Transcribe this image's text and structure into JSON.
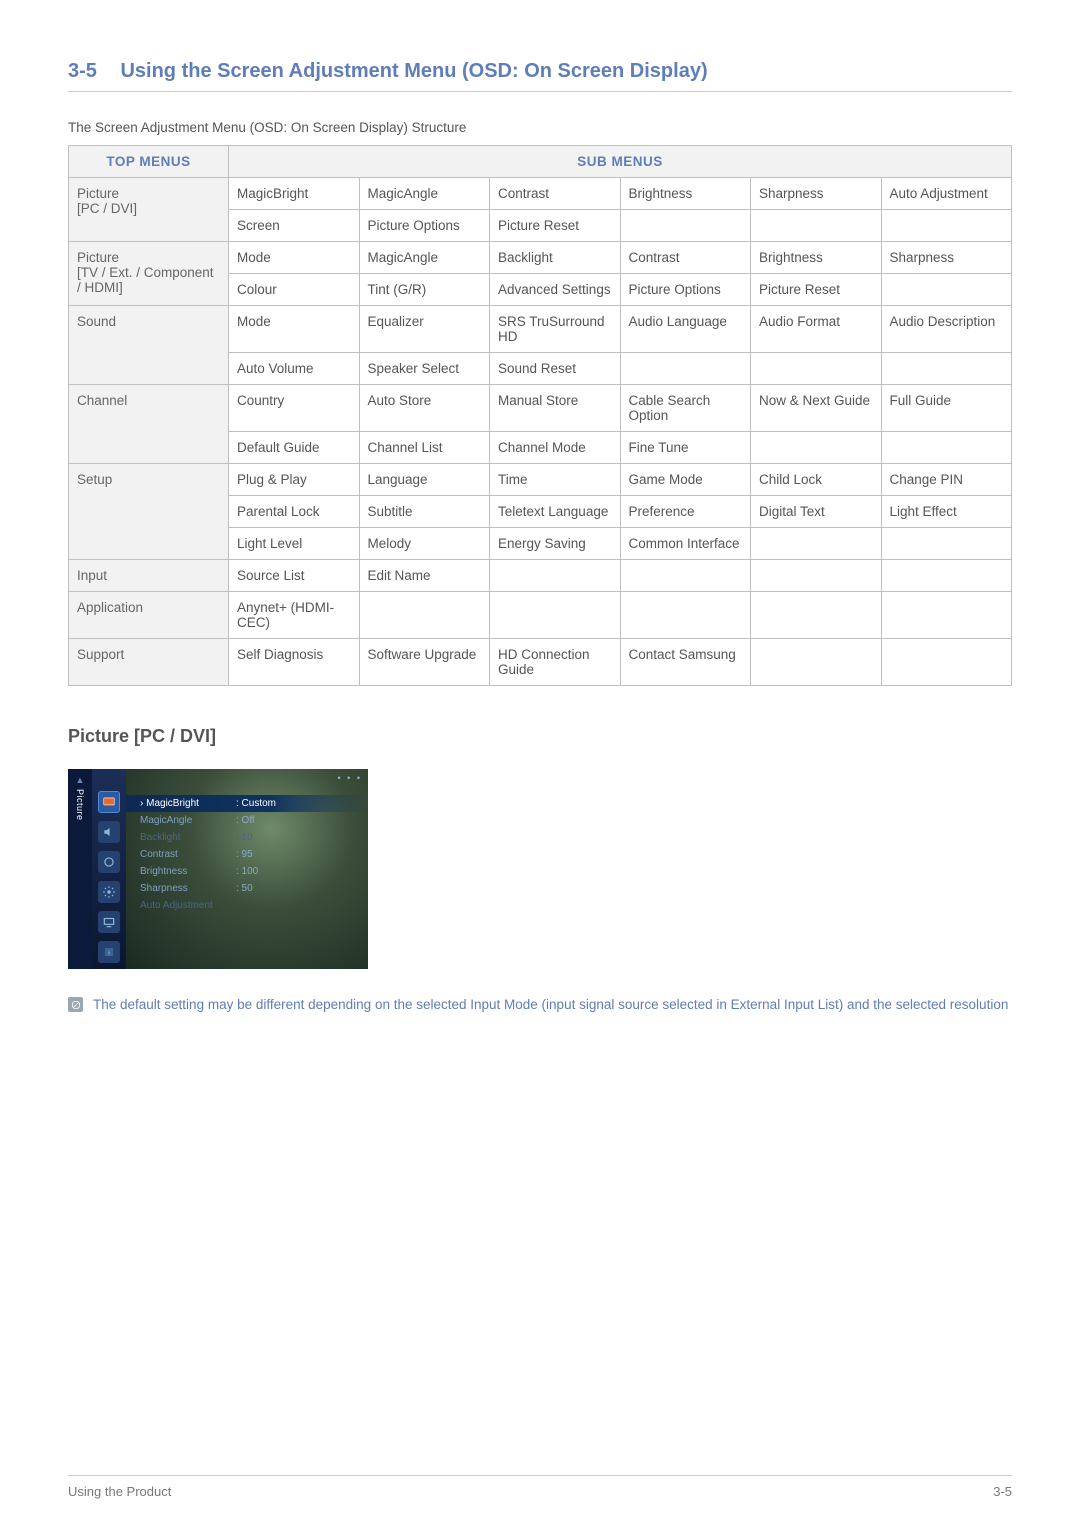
{
  "section": {
    "number": "3-5",
    "title": "Using the Screen Adjustment Menu (OSD: On Screen Display)"
  },
  "intro": "The Screen Adjustment Menu (OSD: On Screen Display) Structure",
  "table": {
    "headers": {
      "top": "TOP MENUS",
      "sub": "SUB MENUS"
    },
    "rows": [
      {
        "top": "Picture\n[PC / DVI]",
        "span": 2,
        "sub": [
          [
            "MagicBright",
            "MagicAngle",
            "Contrast",
            "Brightness",
            "Sharpness",
            "Auto Adjustment"
          ],
          [
            "Screen",
            "Picture Options",
            "Picture Reset",
            "",
            "",
            ""
          ]
        ]
      },
      {
        "top": "Picture\n[TV / Ext. / Component / HDMI]",
        "span": 2,
        "sub": [
          [
            "Mode",
            "MagicAngle",
            "Backlight",
            "Contrast",
            "Brightness",
            "Sharpness"
          ],
          [
            "Colour",
            "Tint (G/R)",
            "Advanced Settings",
            "Picture Options",
            "Picture Reset",
            ""
          ]
        ]
      },
      {
        "top": "Sound",
        "span": 2,
        "sub": [
          [
            "Mode",
            "Equalizer",
            "SRS TruSurround HD",
            "Audio Language",
            "Audio Format",
            "Audio Description"
          ],
          [
            "Auto Volume",
            "Speaker Select",
            "Sound Reset",
            "",
            "",
            ""
          ]
        ]
      },
      {
        "top": "Channel",
        "span": 2,
        "sub": [
          [
            "Country",
            "Auto Store",
            "Manual Store",
            "Cable Search Option",
            "Now & Next Guide",
            "Full Guide"
          ],
          [
            "Default Guide",
            "Channel List",
            "Channel Mode",
            "Fine Tune",
            "",
            ""
          ]
        ]
      },
      {
        "top": "Setup",
        "span": 3,
        "sub": [
          [
            "Plug & Play",
            "Language",
            "Time",
            "Game Mode",
            "Child Lock",
            "Change PIN"
          ],
          [
            "Parental Lock",
            "Subtitle",
            "Teletext Language",
            "Preference",
            "Digital Text",
            "Light Effect"
          ],
          [
            "Light Level",
            "Melody",
            "Energy Saving",
            "Common Interface",
            "",
            ""
          ]
        ]
      },
      {
        "top": "Input",
        "span": 1,
        "sub": [
          [
            "Source List",
            "Edit Name",
            "",
            "",
            "",
            ""
          ]
        ]
      },
      {
        "top": "Application",
        "span": 1,
        "sub": [
          [
            "Anynet+ (HDMI-CEC)",
            "",
            "",
            "",
            "",
            ""
          ]
        ]
      },
      {
        "top": "Support",
        "span": 1,
        "sub": [
          [
            "Self Diagnosis",
            "Software Upgrade",
            "HD Connection Guide",
            "Contact Samsung",
            "",
            ""
          ]
        ]
      }
    ]
  },
  "subheading": "Picture [PC / DVI]",
  "osd": {
    "sidebar_label": "Picture",
    "items": [
      {
        "k": "MagicBright",
        "v": ": Custom",
        "state": "sel"
      },
      {
        "k": "MagicAngle",
        "v": ": Off",
        "state": ""
      },
      {
        "k": "Backlight",
        "v": ": 10",
        "state": "dim"
      },
      {
        "k": "Contrast",
        "v": ": 95",
        "state": ""
      },
      {
        "k": "Brightness",
        "v": ": 100",
        "state": ""
      },
      {
        "k": "Sharpness",
        "v": ": 50",
        "state": ""
      },
      {
        "k": "Auto Adjustment",
        "v": "",
        "state": "dim"
      }
    ]
  },
  "note": "The default setting may be different depending on the selected Input Mode (input signal source selected in External Input List) and the selected resolution",
  "footer": {
    "left": "Using the Product",
    "right": "3-5"
  }
}
